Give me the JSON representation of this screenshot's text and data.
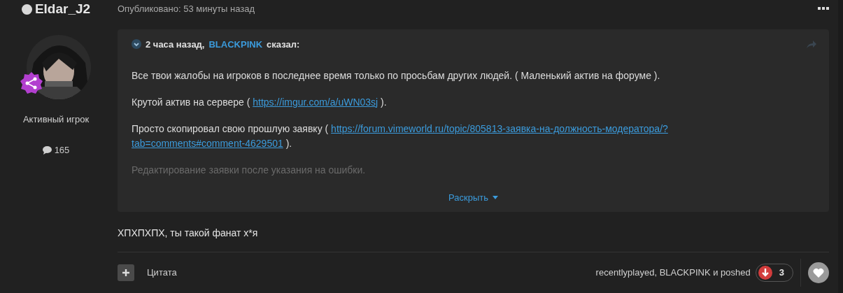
{
  "author": {
    "name": "Eldar_J2",
    "online": false,
    "rank": "Активный игрок",
    "posts": "165"
  },
  "post": {
    "published": "Опубликовано: 53 минуты назад",
    "quote": {
      "time": "2 часа назад,",
      "user": "BLACKPINK",
      "said": "сказал:",
      "expanded": false,
      "paragraphs": [
        [
          {
            "kind": "text",
            "text": "Все твои жалобы на игроков в последнее время только по просьбам других людей. ( Маленький актив на форуме )."
          }
        ],
        [
          {
            "kind": "text",
            "text": "Крутой актив на сервере ("
          },
          {
            "kind": "link",
            "text": "https://imgur.com/a/uWN03sj"
          },
          {
            "kind": "text",
            "text": ")."
          }
        ],
        [
          {
            "kind": "text",
            "text": "Просто скопировал свою прошлую заявку ("
          },
          {
            "kind": "link",
            "text": "https://forum.vimeworld.ru/topic/805813-заявка-на-должность-модератора/?"
          },
          {
            "kind": "break"
          },
          {
            "kind": "link",
            "text": "tab=comments#comment-4629501"
          },
          {
            "kind": "text",
            "text": ")."
          }
        ],
        [
          {
            "kind": "text",
            "text": "Редактирование заявки после указания на ошибки."
          }
        ]
      ],
      "expand": "Раскрыть"
    },
    "body": "ХПХПХПХ, ты такой фанат х*я",
    "quote_button": "Цитата",
    "reactors": "recentlyplayed, BLACKPINK и poshed",
    "reaction_count": "3",
    "liked": false
  }
}
